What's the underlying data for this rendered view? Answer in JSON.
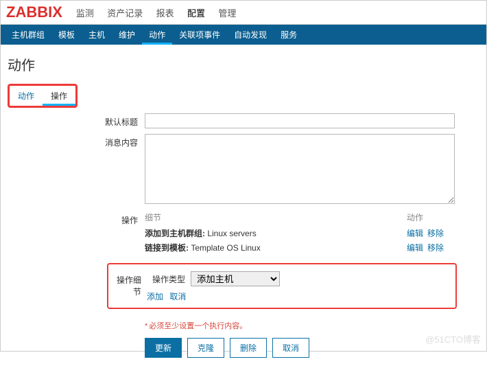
{
  "logo": "ZABBIX",
  "topnav": {
    "items": [
      "监测",
      "资产记录",
      "报表",
      "配置",
      "管理"
    ],
    "active": 3
  },
  "subnav": {
    "items": [
      "主机群组",
      "模板",
      "主机",
      "维护",
      "动作",
      "关联项事件",
      "自动发现",
      "服务"
    ],
    "active": 4
  },
  "page_title": "动作",
  "inner_tabs": {
    "items": [
      "动作",
      "操作"
    ],
    "active": 1
  },
  "form": {
    "subject_label": "默认标题",
    "subject_value": "",
    "message_label": "消息内容",
    "message_value": "",
    "ops_label": "操作",
    "ops_cols": {
      "detail": "细节",
      "action": "动作"
    },
    "ops_rows": [
      {
        "b": "添加到主机群组: ",
        "v": "Linux servers"
      },
      {
        "b": "链接到模板: ",
        "v": "Template OS Linux"
      }
    ],
    "op_row_actions": {
      "edit": "编辑",
      "remove": "移除"
    },
    "detail": {
      "label": "操作细节",
      "type_label": "操作类型",
      "type_value": "添加主机",
      "add": "添加",
      "cancel": "取消"
    },
    "required": "必须至少设置一个执行内容。",
    "buttons": {
      "update": "更新",
      "clone": "克隆",
      "delete": "删除",
      "cancel": "取消"
    }
  },
  "watermark": "@51CTO博客"
}
